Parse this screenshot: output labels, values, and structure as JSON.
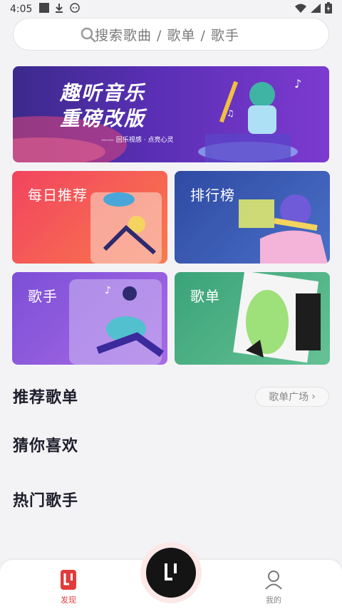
{
  "status_bar": {
    "time": "4:05",
    "icons": [
      "stop-icon",
      "download-icon",
      "android-icon",
      "wifi-icon",
      "signal-icon",
      "battery-icon"
    ]
  },
  "search": {
    "placeholder": "搜索歌曲 / 歌单 / 歌手",
    "icon": "search-icon"
  },
  "banner": {
    "title_line1": "趣听音乐",
    "title_line2": "重磅改版",
    "subtitle": "—— 回乐视感 · 点亮心灵"
  },
  "categories": [
    {
      "label": "每日推荐",
      "color": "#f2445f"
    },
    {
      "label": "排行榜",
      "color": "#2f4aa3"
    },
    {
      "label": "歌手",
      "color": "#7c4fd6"
    },
    {
      "label": "歌单",
      "color": "#3aa378"
    }
  ],
  "sections": {
    "recommended_playlists": {
      "title": "推荐歌单",
      "more_label": "歌单广场"
    },
    "guess_you_like": {
      "title": "猜你喜欢"
    },
    "hot_artists": {
      "title": "热门歌手"
    }
  },
  "tab_bar": {
    "discover_label": "发现",
    "mine_label": "我的",
    "accent": "#e23b3b"
  }
}
